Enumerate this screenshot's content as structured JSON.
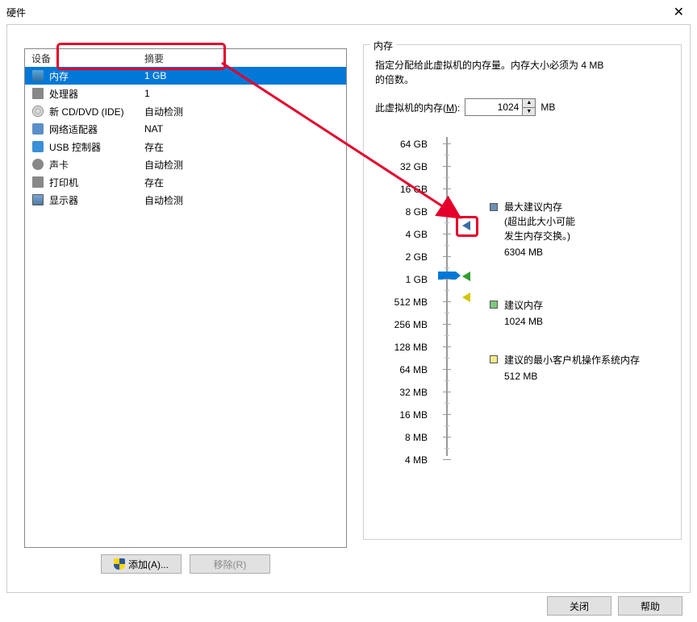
{
  "window": {
    "title": "硬件",
    "close": "✕"
  },
  "device_list": {
    "headers": {
      "device": "设备",
      "summary": "摘要"
    },
    "rows": [
      {
        "icon": "memory-icon",
        "name": "内存",
        "summary": "1 GB",
        "selected": true
      },
      {
        "icon": "cpu-icon",
        "name": "处理器",
        "summary": "1",
        "selected": false
      },
      {
        "icon": "disc-icon",
        "name": "新 CD/DVD (IDE)",
        "summary": "自动检测",
        "selected": false
      },
      {
        "icon": "network-icon",
        "name": "网络适配器",
        "summary": "NAT",
        "selected": false
      },
      {
        "icon": "usb-icon",
        "name": "USB 控制器",
        "summary": "存在",
        "selected": false
      },
      {
        "icon": "sound-icon",
        "name": "声卡",
        "summary": "自动检测",
        "selected": false
      },
      {
        "icon": "printer-icon",
        "name": "打印机",
        "summary": "存在",
        "selected": false
      },
      {
        "icon": "display-icon",
        "name": "显示器",
        "summary": "自动检测",
        "selected": false
      }
    ]
  },
  "buttons": {
    "add": "添加(A)...",
    "remove": "移除(R)",
    "close": "关闭",
    "help": "帮助"
  },
  "memory_panel": {
    "title": "内存",
    "desc1": "指定分配给此虚拟机的内存量。内存大小必须为 4 MB",
    "desc2": "的倍数。",
    "input_label_prefix": "此虚拟机的内存(",
    "input_label_suffix": "):",
    "input_mnemonic": "M",
    "value": "1024",
    "unit": "MB",
    "scale_labels": [
      "64 GB",
      "32 GB",
      "16 GB",
      "8 GB",
      "4 GB",
      "2 GB",
      "1 GB",
      "512 MB",
      "256 MB",
      "128 MB",
      "64 MB",
      "32 MB",
      "16 MB",
      "8 MB",
      "4 MB"
    ],
    "max_rec": {
      "title": "最大建议内存",
      "note1": "(超出此大小可能",
      "note2": "发生内存交换。)",
      "value": "6304 MB"
    },
    "rec": {
      "title": "建议内存",
      "value": "1024 MB"
    },
    "min_rec": {
      "title": "建议的最小客户机操作系统内存",
      "value": "512 MB"
    }
  }
}
